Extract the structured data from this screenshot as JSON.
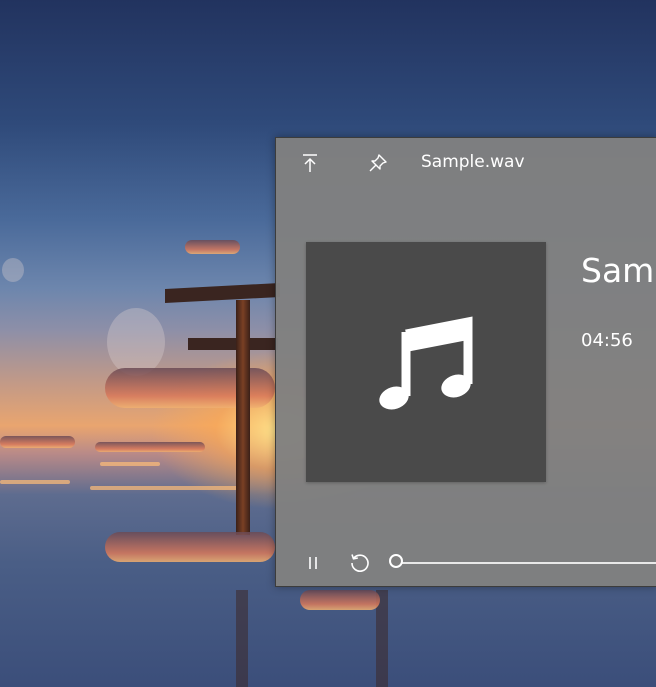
{
  "window": {
    "title": "Sample.wav"
  },
  "titlebar": {
    "buttons": [
      {
        "icon": "keep-on-top-icon"
      },
      {
        "icon": "pin-icon"
      }
    ]
  },
  "album_art": {
    "icon": "music-note-icon",
    "background": "#4a4a4a"
  },
  "track": {
    "title": "Sample",
    "duration": "04:56"
  },
  "controls": {
    "play_pause_icon": "pause-icon",
    "replay_icon": "replay-icon",
    "progress": 0
  },
  "colors": {
    "panel": "#808080",
    "text": "#ffffff"
  }
}
